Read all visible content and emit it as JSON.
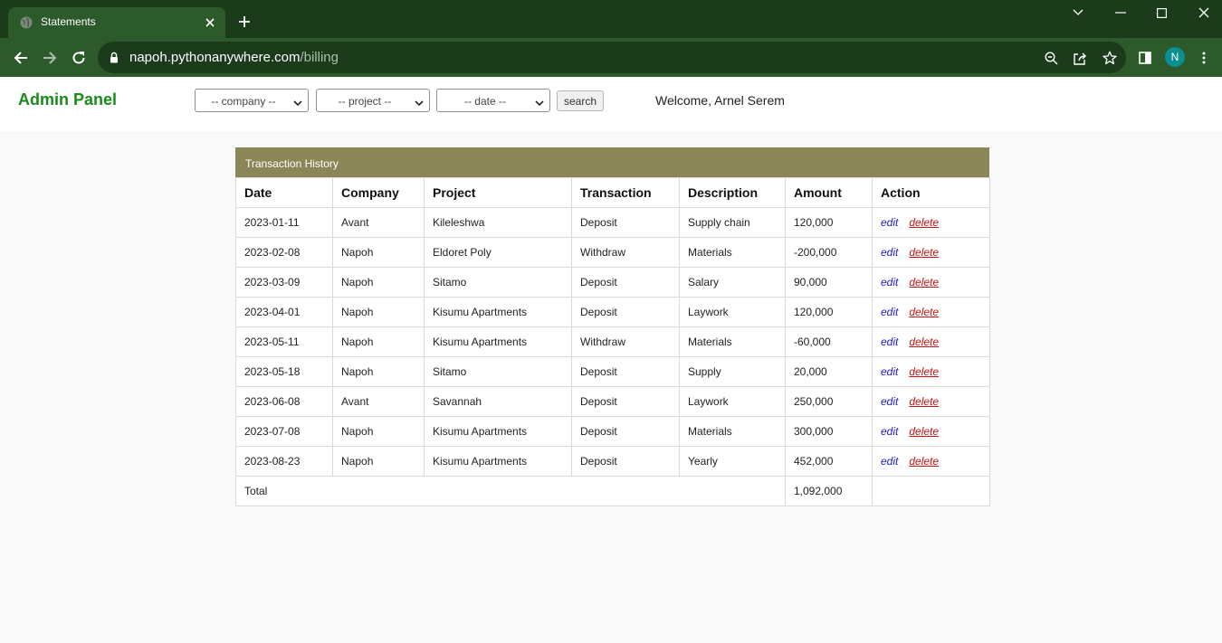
{
  "browser": {
    "tab_title": "Statements",
    "url_host": "napoh.pythonanywhere.com",
    "url_path": "/billing",
    "profile_initial": "N"
  },
  "header": {
    "brand": "Admin Panel",
    "company_select": "-- company --",
    "project_select": "-- project --",
    "date_select": "-- date --",
    "search_label": "search",
    "welcome": "Welcome, Arnel Serem"
  },
  "table": {
    "caption": "Transaction History",
    "columns": [
      "Date",
      "Company",
      "Project",
      "Transaction",
      "Description",
      "Amount",
      "Action"
    ],
    "rows": [
      {
        "date": "2023-01-11",
        "company": "Avant",
        "project": "Kileleshwa",
        "transaction": "Deposit",
        "description": "Supply chain",
        "amount": "120,000"
      },
      {
        "date": "2023-02-08",
        "company": "Napoh",
        "project": "Eldoret Poly",
        "transaction": "Withdraw",
        "description": "Materials",
        "amount": "-200,000"
      },
      {
        "date": "2023-03-09",
        "company": "Napoh",
        "project": "Sitamo",
        "transaction": "Deposit",
        "description": "Salary",
        "amount": "90,000"
      },
      {
        "date": "2023-04-01",
        "company": "Napoh",
        "project": "Kisumu Apartments",
        "transaction": "Deposit",
        "description": "Laywork",
        "amount": "120,000"
      },
      {
        "date": "2023-05-11",
        "company": "Napoh",
        "project": "Kisumu Apartments",
        "transaction": "Withdraw",
        "description": "Materials",
        "amount": "-60,000"
      },
      {
        "date": "2023-05-18",
        "company": "Napoh",
        "project": "Sitamo",
        "transaction": "Deposit",
        "description": "Supply",
        "amount": "20,000"
      },
      {
        "date": "2023-06-08",
        "company": "Avant",
        "project": "Savannah",
        "transaction": "Deposit",
        "description": "Laywork",
        "amount": "250,000"
      },
      {
        "date": "2023-07-08",
        "company": "Napoh",
        "project": "Kisumu Apartments",
        "transaction": "Deposit",
        "description": "Materials",
        "amount": "300,000"
      },
      {
        "date": "2023-08-23",
        "company": "Napoh",
        "project": "Kisumu Apartments",
        "transaction": "Deposit",
        "description": "Yearly",
        "amount": "452,000"
      }
    ],
    "edit_label": "edit",
    "delete_label": "delete",
    "total_label": "Total",
    "total_amount": "1,092,000"
  }
}
